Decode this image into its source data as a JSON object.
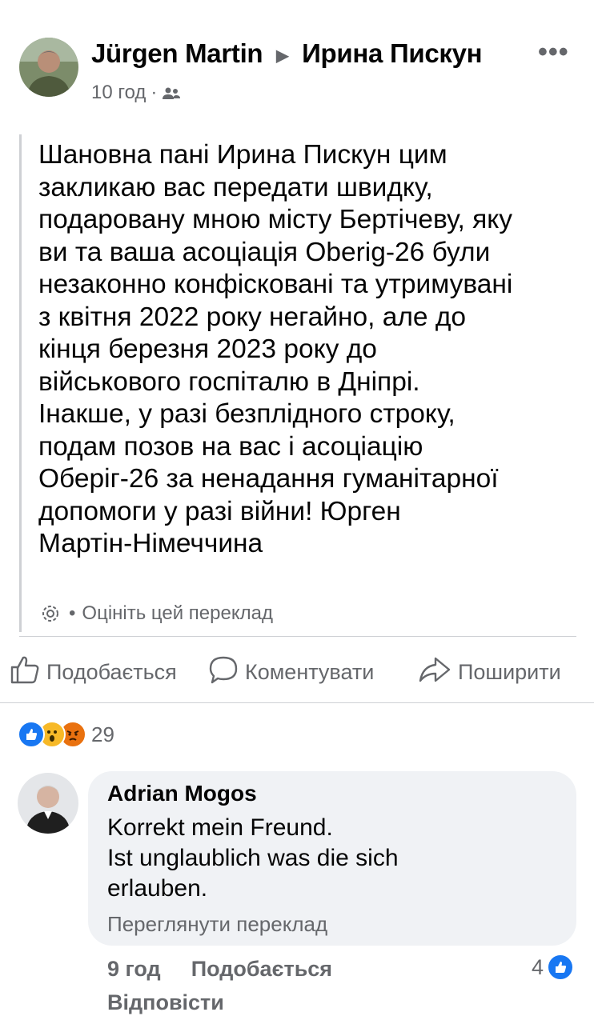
{
  "post": {
    "author": "Jürgen Martin",
    "arrow": "▶",
    "recipient": "Ирина Пискун",
    "time": "10 год",
    "dot": "·",
    "more": "•••",
    "text_lines": [
      "Шановна пані Ирина Пискун цим",
      "закликаю вас передати швидку,",
      "подаровану мною місту Бертічеву, яку",
      "ви та ваша асоціація Oberig-26 були",
      "незаконно конфісковані та утримувані",
      "з квітня 2022 року негайно, але до",
      "кінця березня 2023 року до",
      "військового госпіталю в Дніпрі.",
      "Інакше, у разі безплідного строку,",
      "подам позов на вас і асоціацію",
      "Оберіг-26 за ненадання гуманітарної",
      "допомоги у разі війни! Юрген",
      "Мартін-Німеччина"
    ],
    "translate_dot": "•",
    "translate_label": "Оцініть цей переклад"
  },
  "actions": {
    "like": "Подобається",
    "comment": "Коментувати",
    "share": "Поширити"
  },
  "reactions": {
    "count": "29",
    "colors": {
      "like": "#1877f2",
      "wow": "#f7b928",
      "angry": "#e9710f"
    }
  },
  "comment": {
    "author": "Adrian Mogos",
    "lines": [
      "Korrekt mein Freund.",
      "Ist unglaublich was die sich",
      "erlauben."
    ],
    "see_translation": "Переглянути переклад",
    "time": "9 год",
    "like": "Подобається",
    "reply": "Відповісти",
    "like_count": "4"
  }
}
